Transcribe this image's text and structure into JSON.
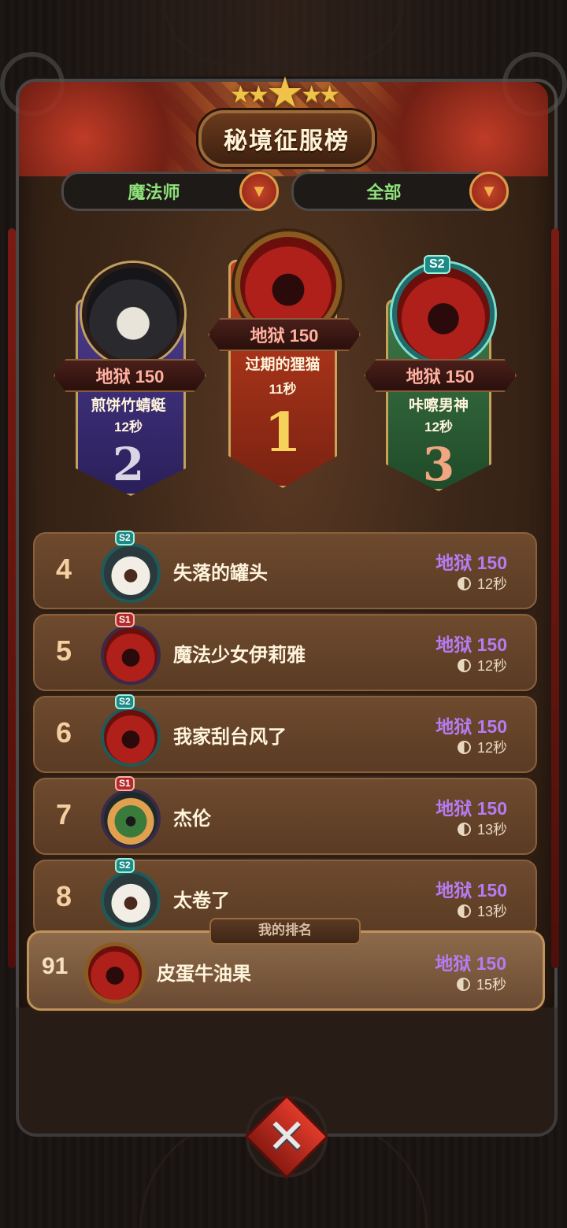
{
  "header": {
    "title": "秘境征服榜",
    "stars": 5
  },
  "filters": {
    "class_label": "魔法师",
    "scope_label": "全部"
  },
  "podium": [
    {
      "rank": "1",
      "name": "过期的狸猫",
      "tier": "地狱 150",
      "time": "11秒",
      "avatar": "red-demon-icon"
    },
    {
      "rank": "2",
      "name": "煎饼竹蜻蜓",
      "tier": "地狱 150",
      "time": "12秒",
      "avatar": "hooded-sheep-icon"
    },
    {
      "rank": "3",
      "name": "咔嚓男神",
      "tier": "地狱 150",
      "time": "12秒",
      "avatar": "red-demon-icon",
      "season": "S2"
    }
  ],
  "list": [
    {
      "rank": "4",
      "name": "失落的罐头",
      "tier": "地狱 150",
      "time": "12秒",
      "season": "S2"
    },
    {
      "rank": "5",
      "name": "魔法少女伊莉雅",
      "tier": "地狱 150",
      "time": "12秒",
      "season": "S1"
    },
    {
      "rank": "6",
      "name": "我家刮台风了",
      "tier": "地狱 150",
      "time": "12秒",
      "season": "S2"
    },
    {
      "rank": "7",
      "name": "杰伦",
      "tier": "地狱 150",
      "time": "13秒",
      "season": "S1"
    },
    {
      "rank": "8",
      "name": "太卷了",
      "tier": "地狱 150",
      "time": "13秒",
      "season": "S2"
    }
  ],
  "my_rank": {
    "label": "我的排名",
    "rank": "91",
    "name": "皮蛋牛油果",
    "tier": "地狱 150",
    "time": "15秒"
  },
  "colors": {
    "tier_purple": "#b57cf2",
    "filter_green": "#8ee27a",
    "accent_red": "#e03a2a"
  },
  "icons": {
    "dropdown": "triangle-down-icon",
    "close": "close-icon",
    "clock": "clock-icon",
    "star": "star-icon"
  }
}
